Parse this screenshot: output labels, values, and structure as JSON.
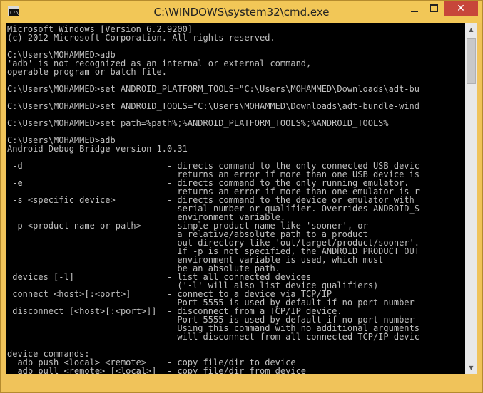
{
  "window": {
    "title": "C:\\WINDOWS\\system32\\cmd.exe",
    "icon_text": "C:\\"
  },
  "controls": {
    "minimize": "minimize",
    "maximize": "maximize",
    "close": "✕"
  },
  "colors": {
    "frame": "#f0c35a",
    "close_button": "#c7463a",
    "console_bg": "#000000",
    "console_fg": "#c0c0c0"
  },
  "console": {
    "lines": [
      "Microsoft Windows [Version 6.2.9200]",
      "(c) 2012 Microsoft Corporation. All rights reserved.",
      "",
      "C:\\Users\\MOHAMMED>adb",
      "'adb' is not recognized as an internal or external command,",
      "operable program or batch file.",
      "",
      "C:\\Users\\MOHAMMED>set ANDROID_PLATFORM_TOOLS=\"C:\\Users\\MOHAMMED\\Downloads\\adt-bu",
      "",
      "C:\\Users\\MOHAMMED>set ANDROID_TOOLS=\"C:\\Users\\MOHAMMED\\Downloads\\adt-bundle-wind",
      "",
      "C:\\Users\\MOHAMMED>set path=%path%;%ANDROID_PLATFORM_TOOLS%;%ANDROID_TOOLS%",
      "",
      "C:\\Users\\MOHAMMED>adb",
      "Android Debug Bridge version 1.0.31",
      "",
      " -d                            - directs command to the only connected USB devic",
      "                                 returns an error if more than one USB device is",
      " -e                            - directs command to the only running emulator.",
      "                                 returns an error if more than one emulator is r",
      " -s <specific device>          - directs command to the device or emulator with",
      "                                 serial number or qualifier. Overrides ANDROID_S",
      "                                 environment variable.",
      " -p <product name or path>     - simple product name like 'sooner', or",
      "                                 a relative/absolute path to a product",
      "                                 out directory like 'out/target/product/sooner'.",
      "                                 If -p is not specified, the ANDROID_PRODUCT_OUT",
      "                                 environment variable is used, which must",
      "                                 be an absolute path.",
      " devices [-l]                  - list all connected devices",
      "                                 ('-l' will also list device qualifiers)",
      " connect <host>[:<port>]       - connect to a device via TCP/IP",
      "                                 Port 5555 is used by default if no port number",
      " disconnect [<host>[:<port>]]  - disconnect from a TCP/IP device.",
      "                                 Port 5555 is used by default if no port number",
      "                                 Using this command with no additional arguments",
      "                                 will disconnect from all connected TCP/IP devic",
      "",
      "device commands:",
      "  adb push <local> <remote>    - copy file/dir to device",
      "  adb pull <remote> [<local>]  - copy file/dir from device"
    ]
  },
  "scrollbar": {
    "up_arrow": "▲",
    "down_arrow": "▼",
    "position": 0.0
  }
}
